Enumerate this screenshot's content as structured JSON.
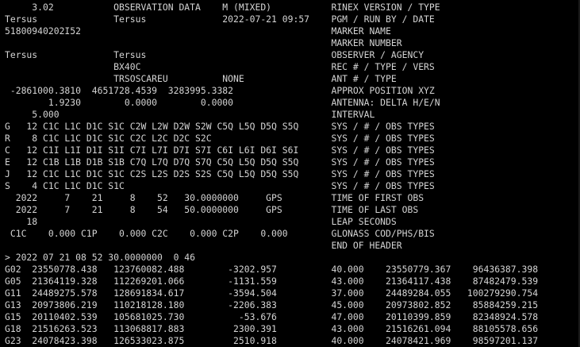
{
  "theme": {
    "background": "#000000",
    "foreground": "#d4d4d4"
  },
  "terminal": {
    "lines": [
      "     3.02           OBSERVATION DATA    M (MIXED)           RINEX VERSION / TYPE",
      "Tersus              Tersus              2022-07-21 09:57    PGM / RUN BY / DATE",
      "51800940202I52                                              MARKER NAME",
      "                                                            MARKER NUMBER",
      "Tersus              Tersus                                  OBSERVER / AGENCY",
      "                    BX40C                                   REC # / TYPE / VERS",
      "                    TRSOSCAREU          NONE                ANT # / TYPE",
      " -2861000.3810  4651728.4539  3283995.3382                  APPROX POSITION XYZ",
      "        1.9230        0.0000        0.0000                  ANTENNA: DELTA H/E/N",
      "     5.000                                                  INTERVAL",
      "G   12 C1C L1C D1C S1C C2W L2W D2W S2W C5Q L5Q D5Q S5Q      SYS / # / OBS TYPES",
      "R    8 C1C L1C D1C S1C C2C L2C D2C S2C                      SYS / # / OBS TYPES",
      "C   12 C1I L1I D1I S1I C7I L7I D7I S7I C6I L6I D6I S6I      SYS / # / OBS TYPES",
      "E   12 C1B L1B D1B S1B C7Q L7Q D7Q S7Q C5Q L5Q D5Q S5Q      SYS / # / OBS TYPES",
      "J   12 C1C L1C D1C S1C C2S L2S D2S S2S C5Q L5Q D5Q S5Q      SYS / # / OBS TYPES",
      "S    4 C1C L1C D1C S1C                                      SYS / # / OBS TYPES",
      "  2022     7    21     8    52   30.0000000     GPS         TIME OF FIRST OBS",
      "  2022     7    21     8    54   50.0000000     GPS         TIME OF LAST OBS",
      "    18                                                      LEAP SECONDS",
      " C1C    0.000 C1P    0.000 C2C    0.000 C2P    0.000        GLONASS COD/PHS/BIS",
      "                                                            END OF HEADER",
      "> 2022 07 21 08 52 30.0000000  0 46",
      "G02  23550778.438   123760082.488        -3202.957          40.000    23550779.367    96436387.398",
      "G05  21364119.328   112269201.066        -1131.559          43.000    21364117.438    87482479.539",
      "G11  24489275.578   128691834.617        -3594.504          37.000    24489284.055   100279290.754",
      "G13  20973806.219   110218128.180        -2206.383          45.000    20973802.852    85884259.215",
      "G15  20110402.539   105681025.730          -53.676          47.000    20110399.859    82348924.578",
      "G18  21516263.523   113068817.883         2300.391          43.000    21516261.094    88105578.656",
      "G23  24078423.398   126533023.875         2510.918          40.000    24078421.969    98597201.137"
    ]
  }
}
